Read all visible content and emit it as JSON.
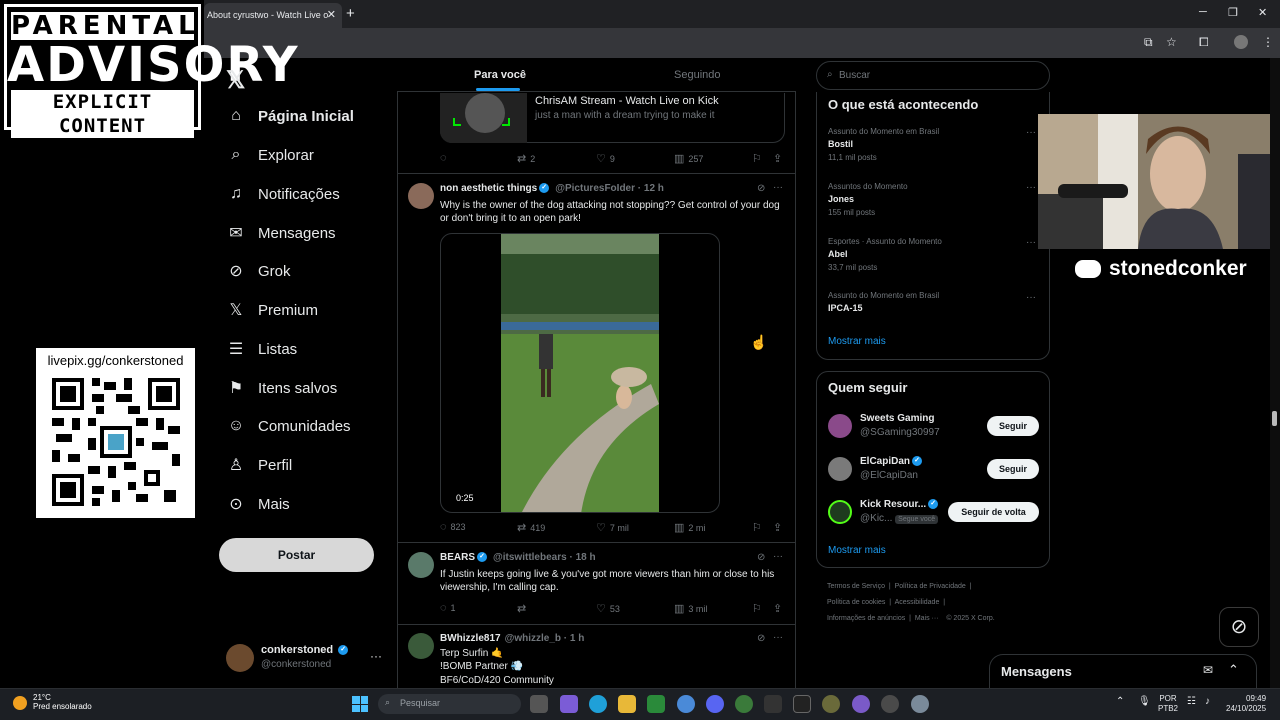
{
  "browser": {
    "tab_title": "About cyrustwo - Watch Live o",
    "new_tab": "+",
    "minimize": "─",
    "restore": "❐",
    "close": "✕"
  },
  "overlay": {
    "parental_l1": "PARENTAL",
    "parental_l2": "ADVISORY",
    "parental_l3": "EXPLICIT CONTENT",
    "livepix": "livepix.gg/conkerstoned",
    "discord_name": "stonedconker"
  },
  "sidebar": {
    "logo": "𝕏",
    "items": [
      {
        "label": "Página Inicial",
        "icon": "home-icon"
      },
      {
        "label": "Explorar",
        "icon": "search-icon"
      },
      {
        "label": "Notificações",
        "icon": "bell-icon"
      },
      {
        "label": "Mensagens",
        "icon": "mail-icon"
      },
      {
        "label": "Grok",
        "icon": "grok-icon"
      },
      {
        "label": "Premium",
        "icon": "x-premium-icon"
      },
      {
        "label": "Listas",
        "icon": "list-icon"
      },
      {
        "label": "Itens salvos",
        "icon": "bookmark-icon"
      },
      {
        "label": "Comunidades",
        "icon": "communities-icon"
      },
      {
        "label": "Perfil",
        "icon": "person-icon"
      },
      {
        "label": "Mais",
        "icon": "more-circle-icon"
      }
    ],
    "post_button": "Postar",
    "profile_name": "conkerstoned",
    "profile_handle": "@conkerstoned",
    "profile_more": "···"
  },
  "feed": {
    "tabs": [
      "Para você",
      "Seguindo"
    ],
    "post0": {
      "card_title": "ChrisAM Stream - Watch Live on Kick",
      "card_sub": "just a man with a dream trying to make it",
      "replies": "",
      "reposts": "2",
      "likes": "9",
      "views": "257"
    },
    "post1": {
      "name": "non aesthetic things",
      "handle": "@PicturesFoIder · 12 h",
      "text": "Why is the owner of the dog attacking not stopping?? Get control of your dog or don't bring it to an open park!",
      "video_time": "0:25",
      "replies": "823",
      "reposts": "419",
      "likes": "7 mil",
      "views": "2 mi"
    },
    "post2": {
      "name": "BEARS",
      "handle": "@itswittlebears · 18 h",
      "text": "If Justin keeps going live & you've got more viewers than him or close to his viewership, I'm calling  cap.",
      "replies": "1",
      "reposts": "",
      "likes": "53",
      "views": "3 mil"
    },
    "post3": {
      "name": "BWhizzle817",
      "handle": "@whizzle_b · 1 h",
      "line1": "Terp Surfin 🤙",
      "line2": "!BOMB Partner 💨",
      "line3": "BF6/CoD/420 Community"
    }
  },
  "right": {
    "search_placeholder": "Buscar",
    "trends_title": "O que está acontecendo",
    "trends": [
      {
        "cat": "Assunto do Momento em Brasil",
        "name": "Bostil",
        "count": "11,1 mil posts"
      },
      {
        "cat": "Assuntos do Momento",
        "name": "Jones",
        "count": "155 mil posts"
      },
      {
        "cat": "Esportes · Assunto do Momento",
        "name": "Abel",
        "count": "33,7 mil posts"
      },
      {
        "cat": "Assunto do Momento em Brasil",
        "name": "IPCA-15",
        "count": ""
      }
    ],
    "show_more": "Mostrar mais",
    "who_title": "Quem seguir",
    "who": [
      {
        "name": "Sweets Gaming",
        "handle": "@SGaming30997",
        "button": "Seguir"
      },
      {
        "name": "ElCapiDan",
        "handle": "@ElCapiDan",
        "button": "Seguir"
      },
      {
        "name": "Kick Resour...",
        "handle": "@Kic...",
        "badge": "Segue você",
        "button": "Seguir de volta"
      }
    ],
    "show_more2": "Mostrar mais",
    "footer": {
      "l1": "Termos de Serviço",
      "l2": "Política de Privacidade",
      "l3": "Política de cookies",
      "l4": "Acessibilidade",
      "l5": "Informações de anúncios",
      "l6": "Mais ···",
      "copy": "© 2025 X Corp."
    }
  },
  "messages": {
    "title": "Mensagens"
  },
  "taskbar": {
    "temp": "21°C",
    "weather": "Pred ensolarado",
    "search": "Pesquisar",
    "lang1": "POR",
    "lang2": "PTB2",
    "time": "09:49",
    "date": "24/10/2025"
  },
  "colors": {
    "accent": "#1d9bf0",
    "bg": "#000000",
    "border": "#2f3336",
    "muted": "#71767b"
  }
}
